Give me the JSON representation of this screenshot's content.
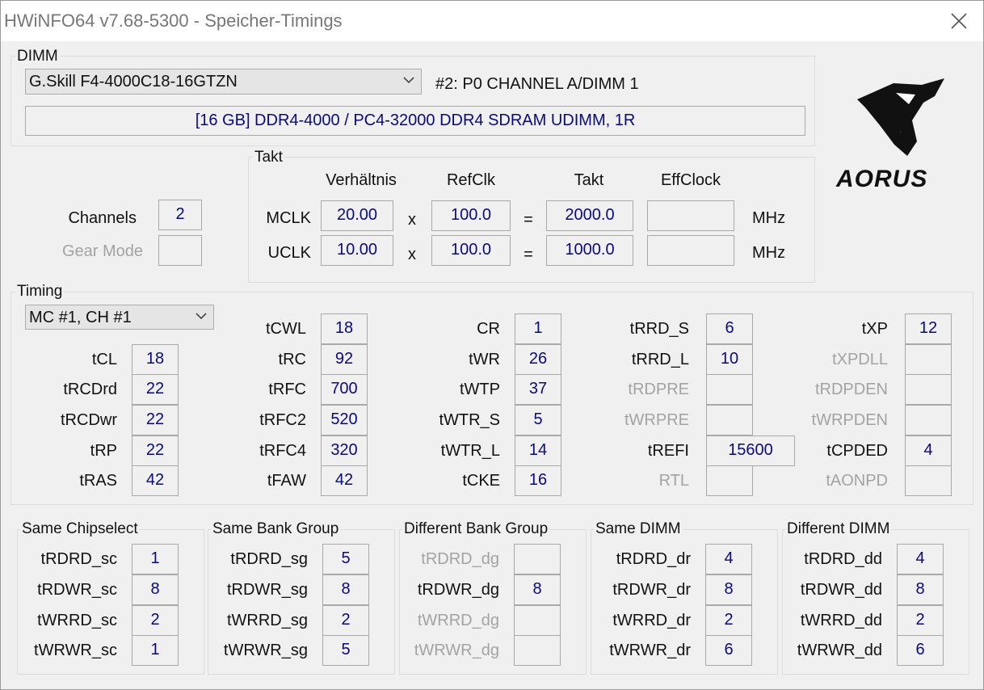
{
  "window": {
    "title": "HWiNFO64 v7.68-5300 - Speicher-Timings"
  },
  "dimm": {
    "group_label": "DIMM",
    "selected_module": "G.Skill F4-4000C18-16GTZN",
    "slot": "#2: P0 CHANNEL A/DIMM 1",
    "description": "[16 GB] DDR4-4000 / PC4-32000 DDR4 SDRAM UDIMM, 1R"
  },
  "logo": {
    "text": "AORUS",
    "icon": "aorus-eagle-logo"
  },
  "channels": {
    "channels_label": "Channels",
    "channels_value": "2",
    "gear_label": "Gear Mode",
    "gear_value": ""
  },
  "takt": {
    "group_label": "Takt",
    "headers": {
      "ratio": "Verhältnis",
      "refclk": "RefClk",
      "takt": "Takt",
      "effclock": "EffClock"
    },
    "rows": [
      {
        "label": "MCLK",
        "ratio": "20.00",
        "x": "x",
        "refclk": "100.0",
        "eq": "=",
        "takt": "2000.0",
        "effclock": "",
        "unit": "MHz"
      },
      {
        "label": "UCLK",
        "ratio": "10.00",
        "x": "x",
        "refclk": "100.0",
        "eq": "=",
        "takt": "1000.0",
        "effclock": "",
        "unit": "MHz"
      }
    ]
  },
  "timing": {
    "group_label": "Timing",
    "channel_select": "MC #1, CH #1",
    "col1": [
      {
        "label": "tCL",
        "value": "18"
      },
      {
        "label": "tRCDrd",
        "value": "22"
      },
      {
        "label": "tRCDwr",
        "value": "22"
      },
      {
        "label": "tRP",
        "value": "22"
      },
      {
        "label": "tRAS",
        "value": "42"
      }
    ],
    "col2": [
      {
        "label": "tCWL",
        "value": "18"
      },
      {
        "label": "tRC",
        "value": "92"
      },
      {
        "label": "tRFC",
        "value": "700"
      },
      {
        "label": "tRFC2",
        "value": "520"
      },
      {
        "label": "tRFC4",
        "value": "320"
      },
      {
        "label": "tFAW",
        "value": "42"
      }
    ],
    "col3": [
      {
        "label": "CR",
        "value": "1"
      },
      {
        "label": "tWR",
        "value": "26"
      },
      {
        "label": "tWTP",
        "value": "37"
      },
      {
        "label": "tWTR_S",
        "value": "5"
      },
      {
        "label": "tWTR_L",
        "value": "14"
      },
      {
        "label": "tCKE",
        "value": "16"
      }
    ],
    "col4": [
      {
        "label": "tRRD_S",
        "value": "6",
        "disabled": false
      },
      {
        "label": "tRRD_L",
        "value": "10",
        "disabled": false
      },
      {
        "label": "tRDPRE",
        "value": "",
        "disabled": true
      },
      {
        "label": "tWRPRE",
        "value": "",
        "disabled": true
      },
      {
        "label": "tREFI",
        "value": "15600",
        "disabled": false
      },
      {
        "label": "RTL",
        "value": "",
        "disabled": true
      }
    ],
    "col5": [
      {
        "label": "tXP",
        "value": "12",
        "disabled": false
      },
      {
        "label": "tXPDLL",
        "value": "",
        "disabled": true
      },
      {
        "label": "tRDPDEN",
        "value": "",
        "disabled": true
      },
      {
        "label": "tWRPDEN",
        "value": "",
        "disabled": true
      },
      {
        "label": "tCPDED",
        "value": "4",
        "disabled": false
      },
      {
        "label": "tAONPD",
        "value": "",
        "disabled": true
      }
    ]
  },
  "groups": [
    {
      "title": "Same Chipselect",
      "rows": [
        {
          "label": "tRDRD_sc",
          "value": "1",
          "disabled": false
        },
        {
          "label": "tRDWR_sc",
          "value": "8",
          "disabled": false
        },
        {
          "label": "tWRRD_sc",
          "value": "2",
          "disabled": false
        },
        {
          "label": "tWRWR_sc",
          "value": "1",
          "disabled": false
        }
      ]
    },
    {
      "title": "Same Bank Group",
      "rows": [
        {
          "label": "tRDRD_sg",
          "value": "5",
          "disabled": false
        },
        {
          "label": "tRDWR_sg",
          "value": "8",
          "disabled": false
        },
        {
          "label": "tWRRD_sg",
          "value": "2",
          "disabled": false
        },
        {
          "label": "tWRWR_sg",
          "value": "5",
          "disabled": false
        }
      ]
    },
    {
      "title": "Different Bank Group",
      "rows": [
        {
          "label": "tRDRD_dg",
          "value": "",
          "disabled": true
        },
        {
          "label": "tRDWR_dg",
          "value": "8",
          "disabled": false
        },
        {
          "label": "tWRRD_dg",
          "value": "",
          "disabled": true
        },
        {
          "label": "tWRWR_dg",
          "value": "",
          "disabled": true
        }
      ]
    },
    {
      "title": "Same DIMM",
      "rows": [
        {
          "label": "tRDRD_dr",
          "value": "4",
          "disabled": false
        },
        {
          "label": "tRDWR_dr",
          "value": "8",
          "disabled": false
        },
        {
          "label": "tWRRD_dr",
          "value": "2",
          "disabled": false
        },
        {
          "label": "tWRWR_dr",
          "value": "6",
          "disabled": false
        }
      ]
    },
    {
      "title": "Different DIMM",
      "rows": [
        {
          "label": "tRDRD_dd",
          "value": "4",
          "disabled": false
        },
        {
          "label": "tRDWR_dd",
          "value": "8",
          "disabled": false
        },
        {
          "label": "tWRRD_dd",
          "value": "2",
          "disabled": false
        },
        {
          "label": "tWRWR_dd",
          "value": "6",
          "disabled": false
        }
      ]
    }
  ]
}
